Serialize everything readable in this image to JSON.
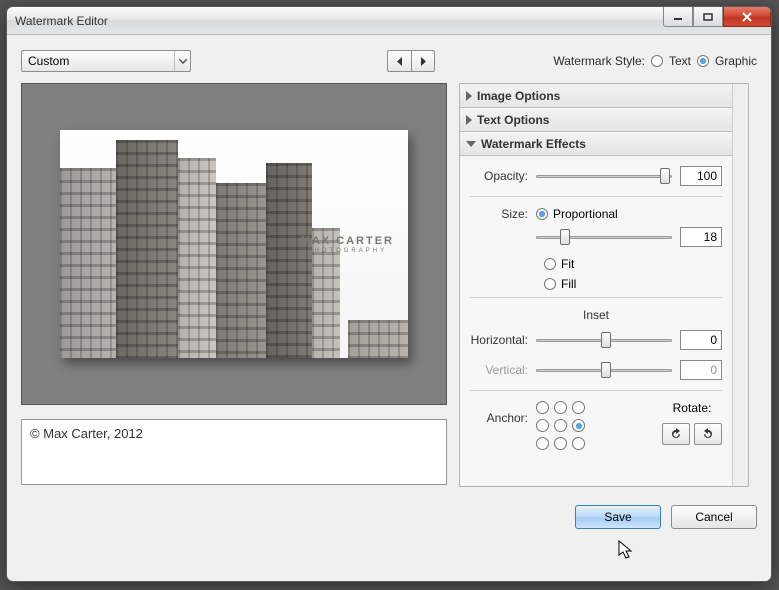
{
  "window": {
    "title": "Watermark Editor"
  },
  "toolbar": {
    "preset_label": "Custom",
    "style_label": "Watermark Style:",
    "style_text": "Text",
    "style_graphic": "Graphic"
  },
  "watermark": {
    "line1": "MAX CARTER",
    "line2": "PHOTOGRAPHY"
  },
  "caption": "© Max Carter, 2012",
  "panel": {
    "image_options": "Image Options",
    "text_options": "Text Options",
    "effects": "Watermark Effects",
    "opacity_label": "Opacity:",
    "opacity_value": "100",
    "size_label": "Size:",
    "size_proportional": "Proportional",
    "size_value": "18",
    "size_fit": "Fit",
    "size_fill": "Fill",
    "inset_label": "Inset",
    "horiz_label": "Horizontal:",
    "horiz_value": "0",
    "vert_label": "Vertical:",
    "vert_value": "0",
    "anchor_label": "Anchor:",
    "rotate_label": "Rotate:"
  },
  "footer": {
    "save": "Save",
    "cancel": "Cancel"
  }
}
